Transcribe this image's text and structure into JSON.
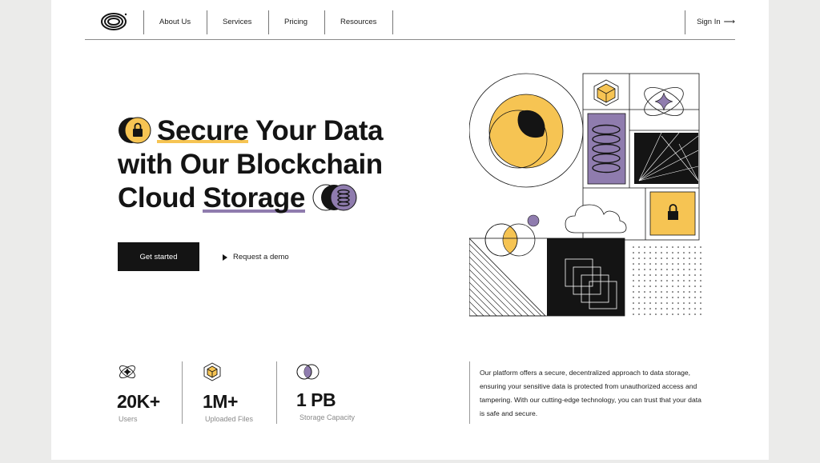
{
  "nav": {
    "links": [
      "About Us",
      "Services",
      "Pricing",
      "Resources"
    ],
    "sign_in": "Sign In",
    "sign_in_arrow": "⟶"
  },
  "hero": {
    "title_line1_highlight": "Secure",
    "title_line1_rest": "Your Data",
    "title_line2": "with Our Blockchain",
    "title_line3_start": "Cloud",
    "title_line3_highlight": "Storage",
    "primary_button": "Get started",
    "secondary_button": "Request a demo"
  },
  "stats": [
    {
      "icon": "atom-icon",
      "value": "20K+",
      "label": "Users"
    },
    {
      "icon": "cube-icon",
      "value": "1M+",
      "label": "Uploaded Files"
    },
    {
      "icon": "overlap-circles-icon",
      "value": "1 PB",
      "label": "Storage Capacity"
    }
  ],
  "description": "Our platform offers a secure, decentralized approach to data storage, ensuring your sensitive data is protected from unauthorized access and tampering. With our cutting-edge technology, you can trust that your data is safe and secure.",
  "colors": {
    "accent_yellow": "#f6c453",
    "accent_purple": "#8f7cae",
    "dark": "#141414",
    "background": "#ebebea",
    "page": "#ffffff"
  }
}
